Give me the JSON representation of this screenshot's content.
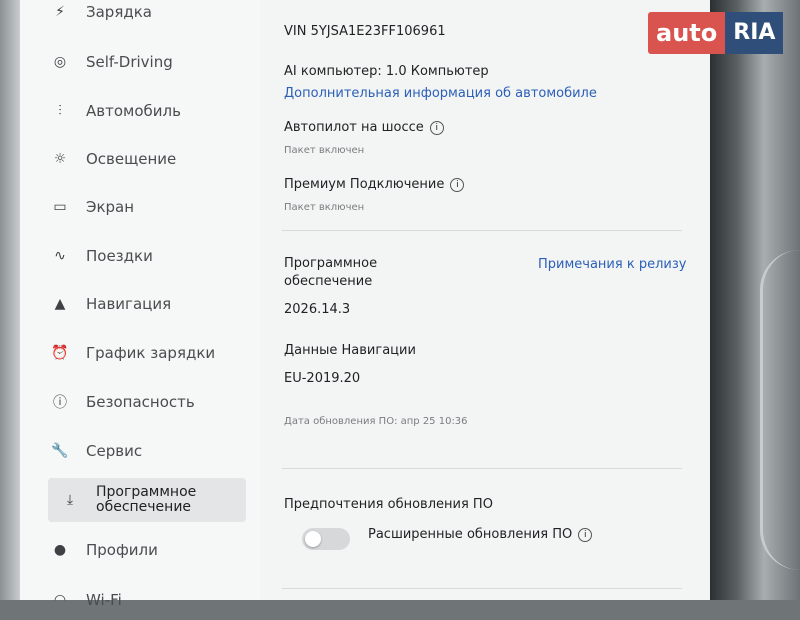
{
  "sidebar": {
    "items": [
      {
        "label": "Зарядка",
        "icon": "bolt-icon",
        "glyph": "⚡"
      },
      {
        "label": "Self-Driving",
        "icon": "steering-wheel-icon",
        "glyph": "◎"
      },
      {
        "label": "Автомобиль",
        "icon": "sliders-icon",
        "glyph": "⫶"
      },
      {
        "label": "Освещение",
        "icon": "sun-icon",
        "glyph": "☼"
      },
      {
        "label": "Экран",
        "icon": "display-icon",
        "glyph": "▭"
      },
      {
        "label": "Поездки",
        "icon": "trips-icon",
        "glyph": "∿"
      },
      {
        "label": "Навигация",
        "icon": "navigation-arrow-icon",
        "glyph": "▲"
      },
      {
        "label": "График зарядки",
        "icon": "alarm-clock-icon",
        "glyph": "⏰"
      },
      {
        "label": "Безопасность",
        "icon": "alert-circle-icon",
        "glyph": "ⓘ"
      },
      {
        "label": "Сервис",
        "icon": "wrench-icon",
        "glyph": "🔧"
      },
      {
        "label": "Программное\nобеспечение",
        "icon": "download-icon",
        "glyph": "⤓"
      },
      {
        "label": "Профили",
        "icon": "person-icon",
        "glyph": "●"
      },
      {
        "label": "Wi-Fi",
        "icon": "wifi-icon",
        "glyph": "◠"
      }
    ]
  },
  "vehicle": {
    "vin": "VIN 5YJSA1E23FF106961",
    "ai_computer": "AI компьютер: 1.0 Компьютер",
    "more_info_link": "Дополнительная информация об автомобиле",
    "autopilot_label": "Автопилот на шоссе",
    "autopilot_status": "Пакет включен",
    "premium_label": "Премиум Подключение",
    "premium_status": "Пакет включен"
  },
  "software": {
    "label_line1": "Программное",
    "label_line2": "обеспечение",
    "release_notes_link": "Примечания к релизу",
    "version": "2026.14.3",
    "nav_data_label": "Данные Навигации",
    "nav_data_value": "EU-2019.20",
    "update_date": "Дата обновления ПО: апр 25 10:36"
  },
  "update_prefs": {
    "title": "Предпочтения обновления ПО",
    "advanced_label": "Расширенные обновления ПО",
    "advanced_enabled": false
  },
  "watermark": {
    "part1": "auto",
    "part2": "RIA"
  }
}
